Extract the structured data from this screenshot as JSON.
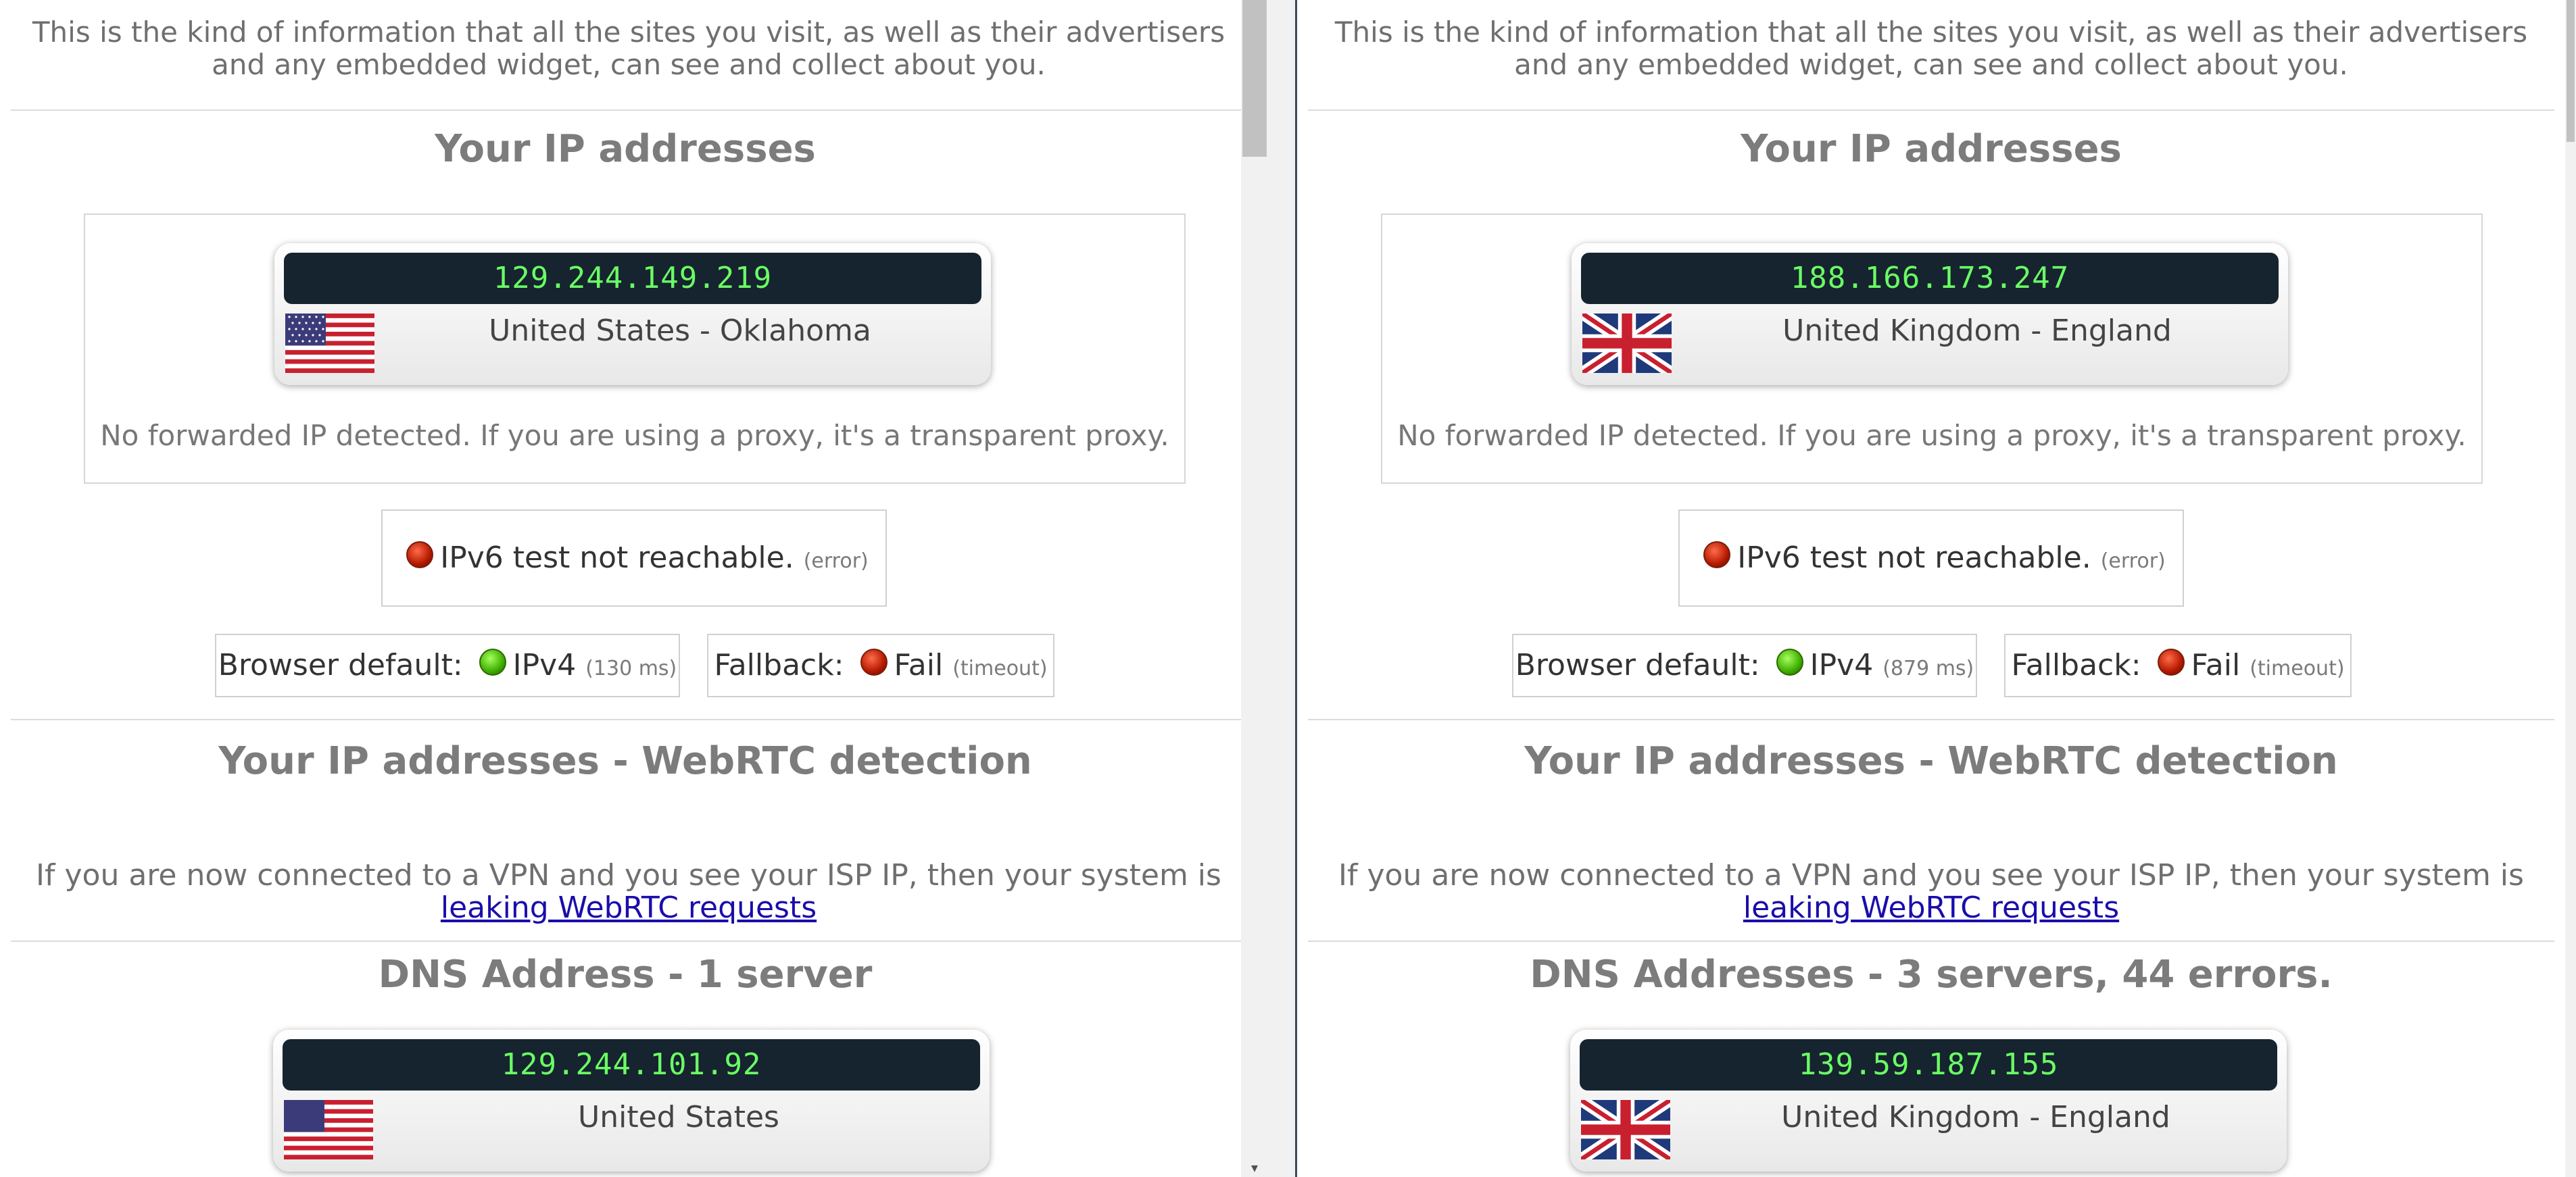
{
  "left": {
    "intro": "This is the kind of information that all the sites you visit, as well as their advertisers and any embedded widget, can see and collect about you.",
    "ip_heading": "Your IP addresses",
    "ip": "129.244.149.219",
    "location": "United States - Oklahoma",
    "flag": "us-flag-icon",
    "forwarded_note": "No forwarded IP detected. If you are using a proxy, it's a transparent proxy.",
    "ipv6_text": "IPv6 test not reachable.",
    "ipv6_status": "(error)",
    "browser_default_label": "Browser default:",
    "browser_default_value": "IPv4",
    "browser_default_time": "(130 ms)",
    "fallback_label": "Fallback:",
    "fallback_value": "Fail",
    "fallback_status": "(timeout)",
    "webrtc_heading": "Your IP addresses - WebRTC detection",
    "webrtc_note_prefix": "If you are now connected to a VPN and you see your ISP IP, then your system is",
    "webrtc_link": "leaking WebRTC requests",
    "dns_heading": "DNS Address - 1 server",
    "dns_ip": "129.244.101.92",
    "dns_location": "United States",
    "dns_flag": "us-flag-icon"
  },
  "right": {
    "intro": "This is the kind of information that all the sites you visit, as well as their advertisers and any embedded widget, can see and collect about you.",
    "ip_heading": "Your IP addresses",
    "ip": "188.166.173.247",
    "location": "United Kingdom - England",
    "flag": "uk-flag-icon",
    "forwarded_note": "No forwarded IP detected. If you are using a proxy, it's a transparent proxy.",
    "ipv6_text": "IPv6 test not reachable.",
    "ipv6_status": "(error)",
    "browser_default_label": "Browser default:",
    "browser_default_value": "IPv4",
    "browser_default_time": "(879 ms)",
    "fallback_label": "Fallback:",
    "fallback_value": "Fail",
    "fallback_status": "(timeout)",
    "webrtc_heading": "Your IP addresses - WebRTC detection",
    "webrtc_note_prefix": "If you are now connected to a VPN and you see your ISP IP, then your system is",
    "webrtc_link": "leaking WebRTC requests",
    "dns_heading": "DNS Addresses - 3 servers, 44 errors.",
    "dns_ip": "139.59.187.155",
    "dns_location": "United Kingdom - England",
    "dns_flag": "uk-flag-icon"
  },
  "colors": {
    "ip_bar_bg": "#15242f",
    "ip_text": "#6bff64",
    "heading": "#7c7c7c",
    "link": "#1a0dab"
  }
}
